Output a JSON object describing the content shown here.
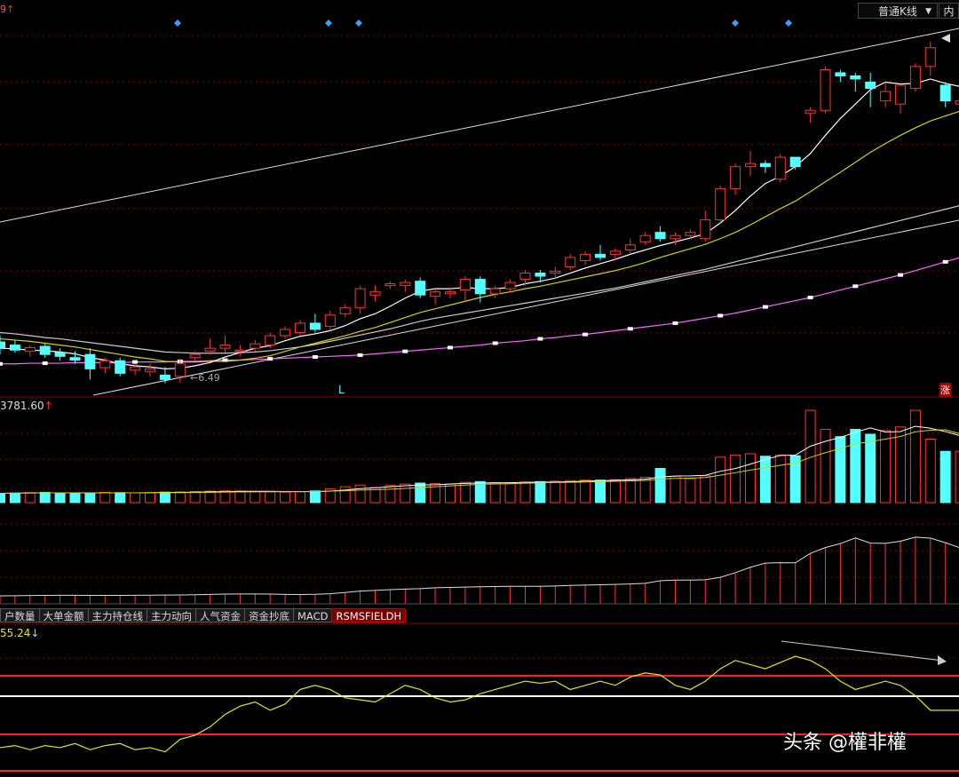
{
  "header": {
    "top_left_fragment": "9",
    "kline_type": "普通K线",
    "fq_label": "内"
  },
  "main_panel": {
    "low_marker_text": "6.49",
    "low_flag": "L",
    "rise_badge": "涨"
  },
  "volume_panel": {
    "value_label": "3781.60"
  },
  "indicator_tabs": [
    "户数量",
    "大单金额",
    "主力持仓线",
    "主力动向",
    "人气资金",
    "资金抄底",
    "MACD",
    "RSMSFIELDH"
  ],
  "active_tab": "RSMSFIELDH",
  "rsi_panel": {
    "value_label": "55.24"
  },
  "watermark": "头条 @權非權",
  "colors": {
    "up": "#ff3232",
    "down": "#54ffff",
    "ma5": "#ffffff",
    "ma10": "#d4d400",
    "ma20": "#cccccc",
    "ma60": "#ff66ff",
    "grid": "#8b0000",
    "arrow_up": "#ff3232",
    "arrow_down": "#54ffff"
  },
  "chart_data": [
    {
      "type": "candlestick",
      "candles_ohlc": [
        [
          7.15,
          7.25,
          6.95,
          7.05
        ],
        [
          7.1,
          7.18,
          6.98,
          7.02
        ],
        [
          7.0,
          7.1,
          6.92,
          7.06
        ],
        [
          7.08,
          7.12,
          6.9,
          6.95
        ],
        [
          6.98,
          7.05,
          6.85,
          6.92
        ],
        [
          6.9,
          7.0,
          6.8,
          6.86
        ],
        [
          6.95,
          7.05,
          6.55,
          6.72
        ],
        [
          6.74,
          6.9,
          6.65,
          6.85
        ],
        [
          6.85,
          6.9,
          6.6,
          6.65
        ],
        [
          6.7,
          6.8,
          6.62,
          6.75
        ],
        [
          6.68,
          6.8,
          6.6,
          6.72
        ],
        [
          6.62,
          6.75,
          6.49,
          6.55
        ],
        [
          6.6,
          6.88,
          6.5,
          6.8
        ],
        [
          6.9,
          7.0,
          6.85,
          6.95
        ],
        [
          7.0,
          7.2,
          6.95,
          7.05
        ],
        [
          7.05,
          7.25,
          6.98,
          7.1
        ],
        [
          7.0,
          7.1,
          6.92,
          7.02
        ],
        [
          7.05,
          7.18,
          7.0,
          7.12
        ],
        [
          7.1,
          7.3,
          7.05,
          7.25
        ],
        [
          7.25,
          7.4,
          7.2,
          7.35
        ],
        [
          7.3,
          7.5,
          7.25,
          7.45
        ],
        [
          7.45,
          7.6,
          7.3,
          7.35
        ],
        [
          7.4,
          7.65,
          7.35,
          7.58
        ],
        [
          7.6,
          7.75,
          7.55,
          7.7
        ],
        [
          7.7,
          8.05,
          7.6,
          8.0
        ],
        [
          7.9,
          8.05,
          7.8,
          7.95
        ],
        [
          8.05,
          8.12,
          8.0,
          8.08
        ],
        [
          8.05,
          8.15,
          7.95,
          8.1
        ],
        [
          8.12,
          8.18,
          7.85,
          7.9
        ],
        [
          7.88,
          8.0,
          7.75,
          7.95
        ],
        [
          7.92,
          8.02,
          7.85,
          7.95
        ],
        [
          7.98,
          8.2,
          7.8,
          8.15
        ],
        [
          8.15,
          8.2,
          7.78,
          7.92
        ],
        [
          7.92,
          8.05,
          7.85,
          8.0
        ],
        [
          8.0,
          8.15,
          7.95,
          8.1
        ],
        [
          8.15,
          8.3,
          8.05,
          8.25
        ],
        [
          8.25,
          8.3,
          8.1,
          8.2
        ],
        [
          8.25,
          8.35,
          8.15,
          8.28
        ],
        [
          8.35,
          8.55,
          8.3,
          8.5
        ],
        [
          8.45,
          8.6,
          8.38,
          8.55
        ],
        [
          8.55,
          8.7,
          8.45,
          8.5
        ],
        [
          8.55,
          8.65,
          8.45,
          8.6
        ],
        [
          8.62,
          8.8,
          8.55,
          8.7
        ],
        [
          8.75,
          8.9,
          8.7,
          8.85
        ],
        [
          8.9,
          9.0,
          8.75,
          8.8
        ],
        [
          8.8,
          8.9,
          8.7,
          8.85
        ],
        [
          8.85,
          8.95,
          8.8,
          8.9
        ],
        [
          8.8,
          9.25,
          8.75,
          9.1
        ],
        [
          9.1,
          9.65,
          9.05,
          9.6
        ],
        [
          9.6,
          10.0,
          9.5,
          9.95
        ],
        [
          9.95,
          10.2,
          9.8,
          10.0
        ],
        [
          10.0,
          10.05,
          9.85,
          9.95
        ],
        [
          9.75,
          10.15,
          9.7,
          10.1
        ],
        [
          10.1,
          10.1,
          9.9,
          9.95
        ],
        [
          10.8,
          10.9,
          10.65,
          10.85
        ],
        [
          10.85,
          11.55,
          10.8,
          11.5
        ],
        [
          11.45,
          11.5,
          11.3,
          11.4
        ],
        [
          11.4,
          11.45,
          11.15,
          11.35
        ],
        [
          11.3,
          11.45,
          10.9,
          11.2
        ],
        [
          11.0,
          11.3,
          10.9,
          11.15
        ],
        [
          10.95,
          11.25,
          10.8,
          11.25
        ],
        [
          11.2,
          11.6,
          11.15,
          11.55
        ],
        [
          11.55,
          11.95,
          11.4,
          11.85
        ],
        [
          11.25,
          11.3,
          10.9,
          11.0
        ],
        [
          10.95,
          11.1,
          10.88,
          11.0
        ],
        [
          11.0,
          11.2,
          10.8,
          11.1
        ],
        [
          11.1,
          11.4,
          11.05,
          11.35
        ],
        [
          11.4,
          11.7,
          11.35,
          11.55
        ],
        [
          11.55,
          11.85,
          11.45,
          11.65
        ],
        [
          11.6,
          12.1,
          11.55,
          12.0
        ],
        [
          11.85,
          11.95,
          11.6,
          11.8
        ]
      ],
      "ma5": [
        7.05,
        7.04,
        7.02,
        7.01,
        6.99,
        6.96,
        6.9,
        6.86,
        6.8,
        6.77,
        6.75,
        6.72,
        6.73,
        6.77,
        6.82,
        6.91,
        6.98,
        7.05,
        7.09,
        7.17,
        7.24,
        7.28,
        7.33,
        7.41,
        7.52,
        7.6,
        7.72,
        7.85,
        7.96,
        8.0,
        8.0,
        8.02,
        8.0,
        8.0,
        8.02,
        8.08,
        8.12,
        8.17,
        8.25,
        8.33,
        8.4,
        8.47,
        8.55,
        8.62,
        8.69,
        8.75,
        8.81,
        8.88,
        9.05,
        9.25,
        9.48,
        9.68,
        9.8,
        9.95,
        10.16,
        10.45,
        10.72,
        10.95,
        11.18,
        11.3,
        11.27,
        11.28,
        11.35,
        11.28,
        11.23,
        11.24,
        11.27,
        11.34,
        11.45,
        11.6,
        11.68
      ],
      "ma10": [
        7.2,
        7.18,
        7.16,
        7.13,
        7.1,
        7.07,
        7.03,
        6.99,
        6.95,
        6.91,
        6.88,
        6.84,
        6.83,
        6.83,
        6.84,
        6.84,
        6.86,
        6.89,
        6.93,
        7.0,
        7.07,
        7.13,
        7.19,
        7.25,
        7.32,
        7.38,
        7.46,
        7.54,
        7.62,
        7.68,
        7.74,
        7.8,
        7.86,
        7.91,
        7.95,
        8.0,
        8.04,
        8.09,
        8.14,
        8.19,
        8.24,
        8.29,
        8.35,
        8.42,
        8.5,
        8.57,
        8.64,
        8.71,
        8.8,
        8.9,
        9.02,
        9.15,
        9.28,
        9.4,
        9.55,
        9.71,
        9.86,
        10.02,
        10.18,
        10.32,
        10.45,
        10.57,
        10.68,
        10.76,
        10.84,
        10.92,
        11.0,
        11.08,
        11.16,
        11.25,
        11.34
      ],
      "ma20": [
        7.3,
        7.28,
        7.25,
        7.22,
        7.2,
        7.17,
        7.14,
        7.11,
        7.08,
        7.05,
        7.02,
        6.99,
        6.98,
        6.97,
        6.97,
        6.97,
        6.98,
        6.99,
        7.01,
        7.04,
        7.07,
        7.11,
        7.16,
        7.21,
        7.26,
        7.31,
        7.36,
        7.42,
        7.48,
        7.53,
        7.57,
        7.61,
        7.65,
        7.69,
        7.73,
        7.77,
        7.81,
        7.85,
        7.89,
        7.93,
        7.97,
        8.01,
        8.06,
        8.11,
        8.16,
        8.21,
        8.26,
        8.31,
        8.37,
        8.43,
        8.49,
        8.55,
        8.61,
        8.67,
        8.73,
        8.79,
        8.85,
        8.91,
        8.97,
        9.03,
        9.09,
        9.15,
        9.21,
        9.27,
        9.33,
        9.39,
        9.45,
        9.51,
        9.57,
        9.63,
        9.69
      ],
      "ma60": [
        6.8,
        6.8,
        6.81,
        6.81,
        6.81,
        6.82,
        6.82,
        6.82,
        6.82,
        6.83,
        6.83,
        6.83,
        6.84,
        6.84,
        6.85,
        6.86,
        6.86,
        6.87,
        6.88,
        6.89,
        6.9,
        6.91,
        6.92,
        6.93,
        6.94,
        6.96,
        6.98,
        7.0,
        7.02,
        7.04,
        7.06,
        7.08,
        7.1,
        7.13,
        7.15,
        7.17,
        7.2,
        7.22,
        7.25,
        7.27,
        7.3,
        7.33,
        7.36,
        7.39,
        7.42,
        7.45,
        7.49,
        7.53,
        7.57,
        7.61,
        7.66,
        7.71,
        7.76,
        7.81,
        7.86,
        7.92,
        7.98,
        8.04,
        8.1,
        8.16,
        8.22,
        8.29,
        8.36,
        8.43,
        8.5,
        8.57,
        8.64,
        8.71,
        8.78,
        8.85,
        8.92
      ],
      "low_point": {
        "index": 11,
        "price": 6.49
      },
      "ylim": [
        6.3,
        12.3
      ]
    },
    {
      "type": "bar",
      "series": "volume",
      "values": [
        380,
        390,
        410,
        420,
        400,
        380,
        390,
        420,
        410,
        400,
        410,
        430,
        440,
        450,
        470,
        480,
        470,
        450,
        440,
        430,
        450,
        480,
        560,
        650,
        720,
        620,
        700,
        760,
        800,
        780,
        760,
        830,
        860,
        820,
        800,
        840,
        860,
        880,
        900,
        920,
        920,
        940,
        980,
        1040,
        1400,
        1080,
        980,
        1100,
        1860,
        1950,
        2000,
        1900,
        1950,
        1920,
        3781,
        3000,
        2700,
        3000,
        2800,
        2950,
        3100,
        3781,
        2600,
        2100,
        2100,
        2000,
        1900,
        2000,
        2100,
        2600,
        2700
      ],
      "ylim": [
        0,
        3781.6
      ]
    },
    {
      "type": "line",
      "series": "RSMSFIELDH",
      "values": [
        42,
        43,
        41,
        43,
        42,
        44,
        41,
        43,
        44,
        41,
        42,
        40,
        46,
        48,
        52,
        58,
        62,
        64,
        60,
        63,
        70,
        72,
        70,
        66,
        65,
        64,
        68,
        72,
        70,
        66,
        64,
        65,
        68,
        70,
        72,
        74,
        73,
        74,
        70,
        72,
        74,
        72,
        76,
        78,
        77,
        72,
        70,
        74,
        80,
        84,
        82,
        80,
        83,
        86,
        84,
        80,
        74,
        70,
        72,
        74,
        72,
        67,
        60,
        60,
        60,
        62,
        66,
        68,
        69,
        75,
        68
      ],
      "ylim": [
        30,
        95
      ]
    }
  ]
}
